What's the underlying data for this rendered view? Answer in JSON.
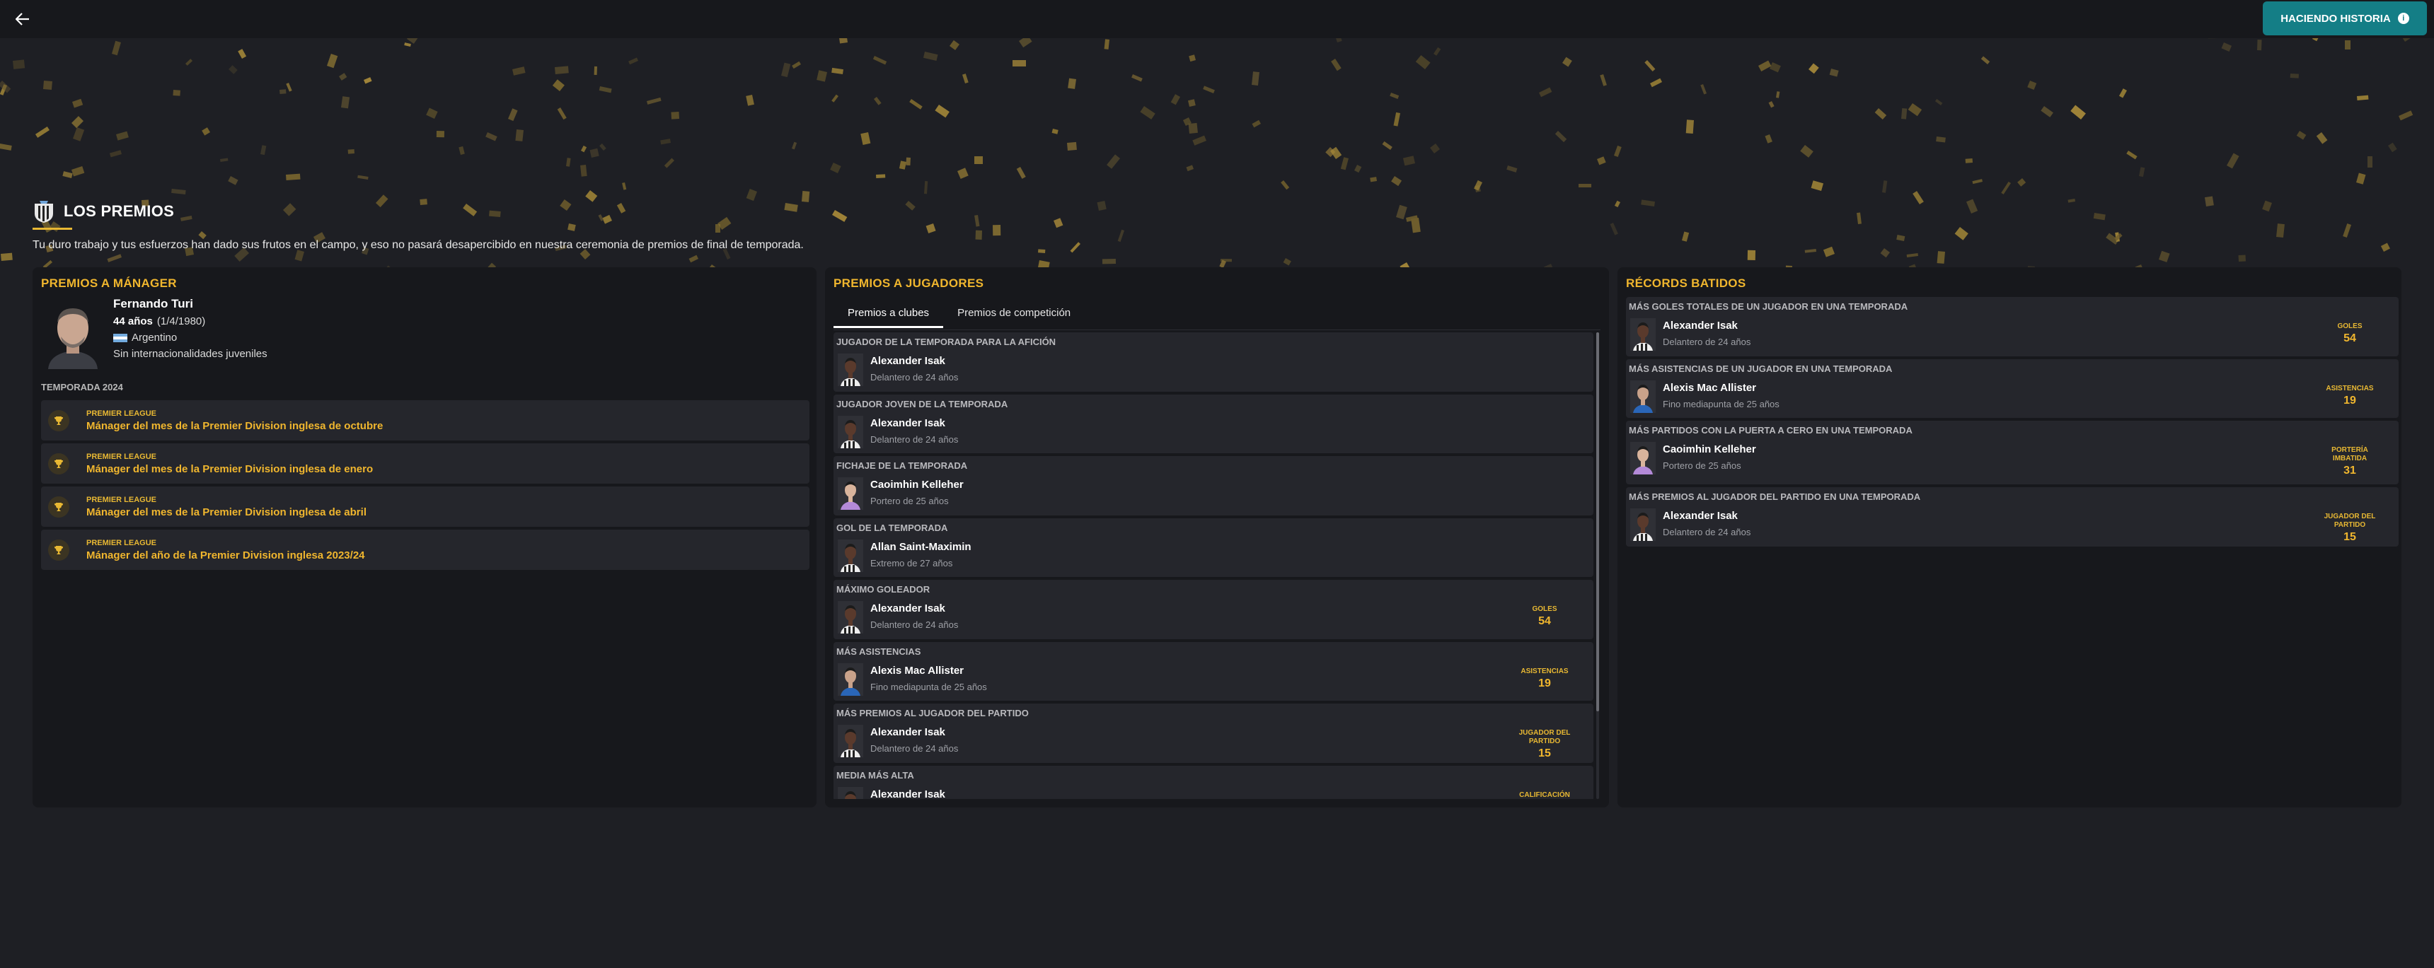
{
  "topbar": {
    "back_icon": "arrow-left-icon",
    "history_button": "HACIENDO HISTORIA",
    "history_info": "i"
  },
  "hero": {
    "title": "LOS PREMIOS",
    "description": "Tu duro trabajo y tus esfuerzos han dado sus frutos en el campo, y eso no pasará desapercibido en nuestra ceremonia de premios de final de temporada."
  },
  "manager_panel": {
    "title": "PREMIOS A MÁNAGER",
    "name": "Fernando Turi",
    "age": "44 años",
    "dob": "(1/4/1980)",
    "nationality": "Argentino",
    "international": "Sin internacionalidades juveniles",
    "season": "TEMPORADA 2024",
    "awards": [
      {
        "league": "PREMIER LEAGUE",
        "name": "Mánager del mes de la Premier Division inglesa de octubre"
      },
      {
        "league": "PREMIER LEAGUE",
        "name": "Mánager del mes de la Premier Division inglesa de enero"
      },
      {
        "league": "PREMIER LEAGUE",
        "name": "Mánager del mes de la Premier Division inglesa de abril"
      },
      {
        "league": "PREMIER LEAGUE",
        "name": "Mánager del año de la Premier Division inglesa 2023/24"
      }
    ]
  },
  "player_panel": {
    "title": "PREMIOS A JUGADORES",
    "tabs": [
      "Premios a clubes",
      "Premios de competición"
    ],
    "active_tab": 0,
    "awards": [
      {
        "category": "JUGADOR DE LA TEMPORADA PARA LA AFICIÓN",
        "player": "Alexander Isak",
        "detail": "Delantero de 24 años",
        "stat_label": "",
        "stat_value": ""
      },
      {
        "category": "JUGADOR JOVEN DE LA TEMPORADA",
        "player": "Alexander Isak",
        "detail": "Delantero de 24 años",
        "stat_label": "",
        "stat_value": ""
      },
      {
        "category": "FICHAJE DE LA TEMPORADA",
        "player": "Caoimhin Kelleher",
        "detail": "Portero de 25 años",
        "stat_label": "",
        "stat_value": ""
      },
      {
        "category": "GOL DE LA TEMPORADA",
        "player": "Allan Saint-Maximin",
        "detail": "Extremo de 27 años",
        "stat_label": "",
        "stat_value": ""
      },
      {
        "category": "MÁXIMO GOLEADOR",
        "player": "Alexander Isak",
        "detail": "Delantero de 24 años",
        "stat_label": "GOLES",
        "stat_value": "54"
      },
      {
        "category": "MÁS ASISTENCIAS",
        "player": "Alexis Mac Allister",
        "detail": "Fino mediapunta de 25 años",
        "stat_label": "ASISTENCIAS",
        "stat_value": "19"
      },
      {
        "category": "MÁS PREMIOS AL JUGADOR DEL PARTIDO",
        "player": "Alexander Isak",
        "detail": "Delantero de 24 años",
        "stat_label": "JUGADOR DEL PARTIDO",
        "stat_value": "15"
      },
      {
        "category": "MEDIA MÁS ALTA",
        "player": "Alexander Isak",
        "detail": "",
        "stat_label": "CALIFICACIÓN",
        "stat_value": ""
      }
    ]
  },
  "records_panel": {
    "title": "RÉCORDS BATIDOS",
    "records": [
      {
        "category": "MÁS GOLES TOTALES DE UN JUGADOR EN UNA TEMPORADA",
        "player": "Alexander Isak",
        "detail": "Delantero de 24 años",
        "stat_label": "GOLES",
        "stat_value": "54"
      },
      {
        "category": "MÁS ASISTENCIAS DE UN JUGADOR EN UNA TEMPORADA",
        "player": "Alexis Mac Allister",
        "detail": "Fino mediapunta de 25 años",
        "stat_label": "ASISTENCIAS",
        "stat_value": "19"
      },
      {
        "category": "MÁS PARTIDOS CON LA PUERTA A CERO EN UNA TEMPORADA",
        "player": "Caoimhin Kelleher",
        "detail": "Portero de 25 años",
        "stat_label": "PORTERÍA IMBATIDA",
        "stat_value": "31"
      },
      {
        "category": "MÁS PREMIOS AL JUGADOR DEL PARTIDO EN UNA TEMPORADA",
        "player": "Alexander Isak",
        "detail": "Delantero de 24 años",
        "stat_label": "JUGADOR DEL PARTIDO",
        "stat_value": "15"
      }
    ]
  },
  "colors": {
    "accent_gold": "#f0b62e",
    "teal_button": "#147e86",
    "background": "#1e1f24",
    "panel": "#17181c"
  }
}
